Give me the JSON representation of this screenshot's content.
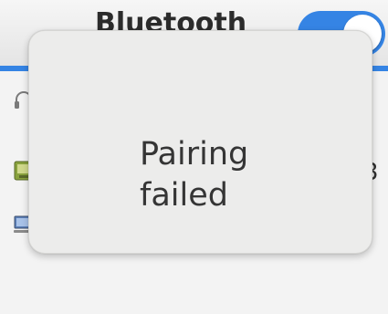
{
  "window": {
    "title": "Bluetooth",
    "bluetooth_enabled": true,
    "accent_color": "#3584e4"
  },
  "device_list": {
    "items": [
      {
        "icon": "headset-icon"
      },
      {
        "icon": "phone-icon",
        "status": "3"
      },
      {
        "icon": "computer-icon"
      }
    ]
  },
  "notification": {
    "message": "Pairing\nfailed"
  }
}
